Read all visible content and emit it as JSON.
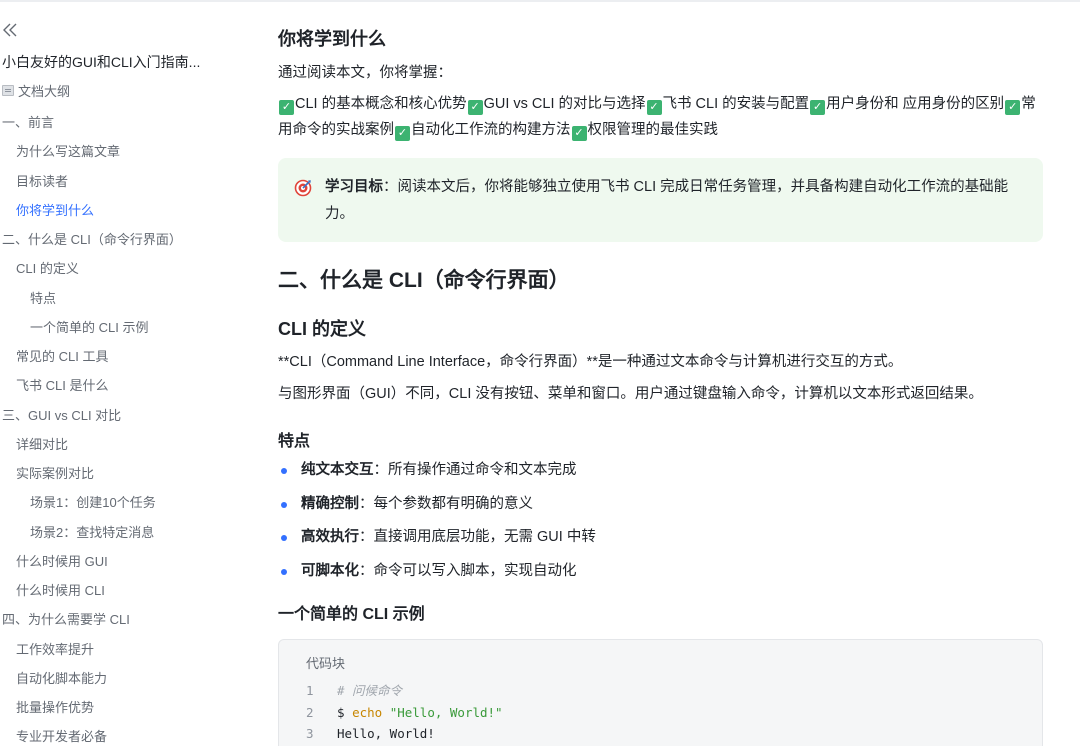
{
  "sidebar": {
    "doc_title": "小白友好的GUI和CLI入门指南...",
    "outline_label": "文档大纲",
    "items": [
      {
        "label": "一、前言",
        "level": 1
      },
      {
        "label": "为什么写这篇文章",
        "level": 2
      },
      {
        "label": "目标读者",
        "level": 2
      },
      {
        "label": "你将学到什么",
        "level": 2,
        "active": true
      },
      {
        "label": "二、什么是 CLI（命令行界面）",
        "level": 1
      },
      {
        "label": "CLI 的定义",
        "level": 2
      },
      {
        "label": "特点",
        "level": 3
      },
      {
        "label": "一个简单的 CLI 示例",
        "level": 3
      },
      {
        "label": "常见的 CLI 工具",
        "level": 2
      },
      {
        "label": "飞书 CLI 是什么",
        "level": 2
      },
      {
        "label": "三、GUI vs CLI 对比",
        "level": 1
      },
      {
        "label": "详细对比",
        "level": 2
      },
      {
        "label": "实际案例对比",
        "level": 2
      },
      {
        "label": "场景1：创建10个任务",
        "level": 3
      },
      {
        "label": "场景2：查找特定消息",
        "level": 3
      },
      {
        "label": "什么时候用 GUI",
        "level": 2
      },
      {
        "label": "什么时候用 CLI",
        "level": 2
      },
      {
        "label": "四、为什么需要学 CLI",
        "level": 1
      },
      {
        "label": "工作效率提升",
        "level": 2
      },
      {
        "label": "自动化脚本能力",
        "level": 2
      },
      {
        "label": "批量操作优势",
        "level": 2
      },
      {
        "label": "专业开发者必备",
        "level": 2
      }
    ]
  },
  "content": {
    "section_learn_title": "你将学到什么",
    "learn_intro": "通过阅读本文，你将掌握：",
    "learn_items": [
      "CLI 的基本概念和核心优势",
      "GUI vs CLI 的对比与选择",
      "飞书 CLI 的安装与配置",
      "用户身份和 应用身份的区别",
      "常用命令的实战案例",
      "自动化工作流的构建方法",
      "权限管理的最佳实践"
    ],
    "callout": {
      "label": "学习目标",
      "text": "：阅读本文后，你将能够独立使用飞书 CLI 完成日常任务管理，并具备构建自动化工作流的基础能力。"
    },
    "section2_title": "二、什么是 CLI（命令行界面）",
    "cli_def_title": "CLI 的定义",
    "cli_def_p1": "**CLI（Command Line Interface，命令行界面）**是一种通过文本命令与计算机进行交互的方式。",
    "cli_def_p2": "与图形界面（GUI）不同，CLI 没有按钮、菜单和窗口。用户通过键盘输入命令，计算机以文本形式返回结果。",
    "features_title": "特点",
    "features": [
      {
        "term": "纯文本交互",
        "desc": "：所有操作通过命令和文本完成"
      },
      {
        "term": "精确控制",
        "desc": "：每个参数都有明确的意义"
      },
      {
        "term": "高效执行",
        "desc": "：直接调用底层功能，无需 GUI 中转"
      },
      {
        "term": "可脚本化",
        "desc": "：命令可以写入脚本，实现自动化"
      }
    ],
    "example_title": "一个简单的 CLI 示例",
    "code_label": "代码块",
    "code": {
      "line1_no": "1",
      "line1": "# 问候命令",
      "line2_no": "2",
      "line2_prompt": "$ ",
      "line2_cmd": "echo",
      "line2_str": "\"Hello, World!\"",
      "line3_no": "3",
      "line3": "Hello, World!"
    }
  }
}
